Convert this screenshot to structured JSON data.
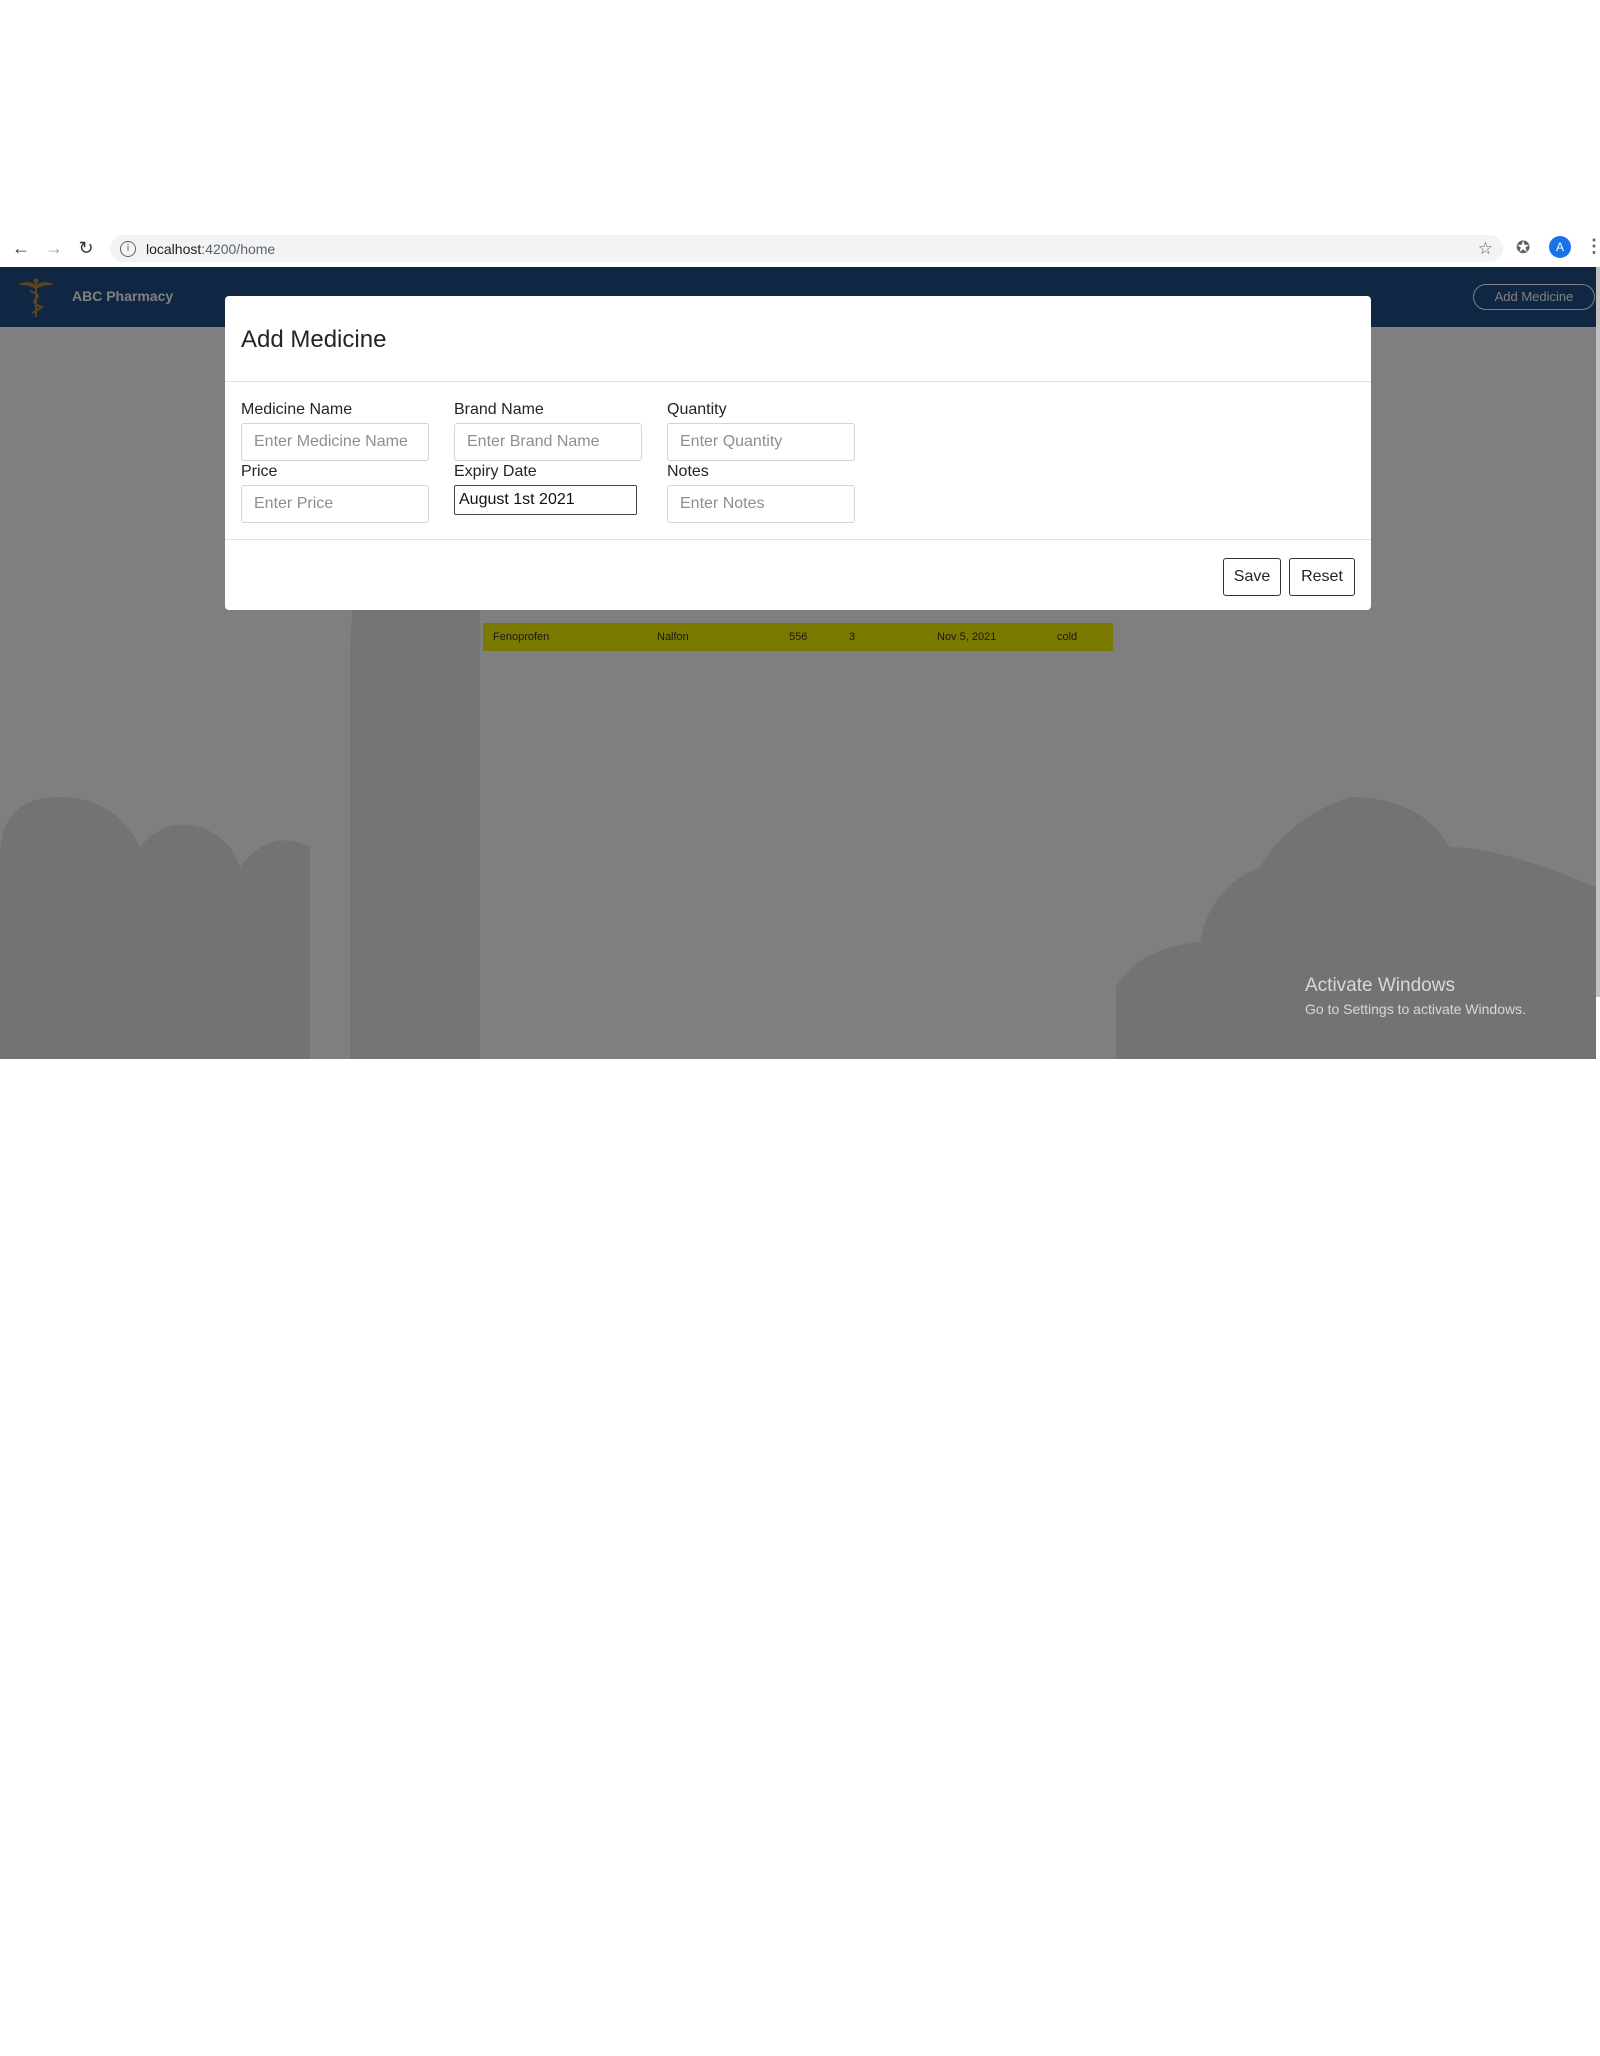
{
  "browser": {
    "url_host": "localhost",
    "url_path": ":4200/home",
    "avatar_letter": "A",
    "icons": [
      "back-icon",
      "forward-icon",
      "reload-icon",
      "info-icon",
      "star-icon",
      "extensions-icon",
      "menu-icon"
    ]
  },
  "app": {
    "brand": "ABC Pharmacy",
    "add_medicine_button": "Add Medicine",
    "header_color": "#1f4f86"
  },
  "table": {
    "visible_row": {
      "medicine": "Fenoprofen",
      "brand": "Nalfon",
      "price": "556",
      "quantity": "3",
      "expiry": "Nov 5, 2021",
      "notes": "cold"
    },
    "highlight_color": "#f5f500"
  },
  "modal": {
    "title": "Add Medicine",
    "fields": {
      "medicine_name": {
        "label": "Medicine Name",
        "placeholder": "Enter Medicine Name",
        "value": ""
      },
      "brand_name": {
        "label": "Brand Name",
        "placeholder": "Enter Brand Name",
        "value": ""
      },
      "quantity": {
        "label": "Quantity",
        "placeholder": "Enter Quantity",
        "value": ""
      },
      "price": {
        "label": "Price",
        "placeholder": "Enter Price",
        "value": ""
      },
      "expiry_date": {
        "label": "Expiry Date",
        "placeholder": "",
        "value": "August 1st 2021"
      },
      "notes": {
        "label": "Notes",
        "placeholder": "Enter Notes",
        "value": ""
      }
    },
    "save_label": "Save",
    "reset_label": "Reset"
  },
  "watermark": {
    "title": "Activate Windows",
    "subtitle": "Go to Settings to activate Windows."
  }
}
